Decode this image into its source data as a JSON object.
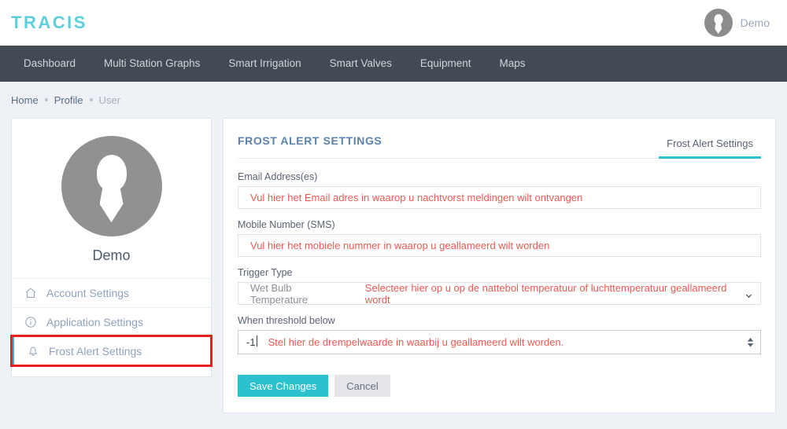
{
  "brand": {
    "logo": "TRACIS"
  },
  "header": {
    "user_name": "Demo",
    "avatar_icon": "user-avatar-icon"
  },
  "nav": {
    "items": [
      {
        "label": "Dashboard"
      },
      {
        "label": "Multi Station Graphs"
      },
      {
        "label": "Smart Irrigation"
      },
      {
        "label": "Smart Valves"
      },
      {
        "label": "Equipment"
      },
      {
        "label": "Maps"
      }
    ]
  },
  "breadcrumb": {
    "items": [
      {
        "label": "Home",
        "muted": false
      },
      {
        "label": "Profile",
        "muted": false
      },
      {
        "label": "User",
        "muted": true
      }
    ]
  },
  "sidebar": {
    "profile_name": "Demo",
    "items": [
      {
        "label": "Account Settings",
        "icon": "home-icon"
      },
      {
        "label": "Application Settings",
        "icon": "info-circle-icon"
      },
      {
        "label": "Frost Alert Settings",
        "icon": "bell-icon"
      }
    ]
  },
  "main": {
    "panel_title": "FROST ALERT SETTINGS",
    "tab_label": "Frost Alert Settings",
    "fields": {
      "email": {
        "label": "Email Address(es)",
        "value": "",
        "placeholder": "Vul hier het Email adres in waarop u nachtvorst meldingen wilt ontvangen"
      },
      "mobile": {
        "label": "Mobile Number (SMS)",
        "value": "",
        "placeholder": "Vul hier het mobiele nummer in waarop u geallameerd wilt worden"
      },
      "trigger": {
        "label": "Trigger Type",
        "selected": "Wet Bulb Temperature",
        "hint": "Selecteer hier op u op de nattebol temperatuur of luchttemperatuur geallameerd wordt"
      },
      "threshold": {
        "label": "When threshold below",
        "value": "-1",
        "hint": "Stel hier de drempelwaarde in waarbij u geallameerd wilt worden."
      }
    },
    "buttons": {
      "save": "Save Changes",
      "cancel": "Cancel"
    }
  },
  "colors": {
    "brand_teal": "#5ccfdd",
    "accent_teal": "#2cc1cf",
    "navbar": "#434a54",
    "page_bg": "#eef1f6",
    "error_red": "#ed5a52",
    "highlight_red": "#e81d1d",
    "title_blue": "#5b82ad"
  }
}
